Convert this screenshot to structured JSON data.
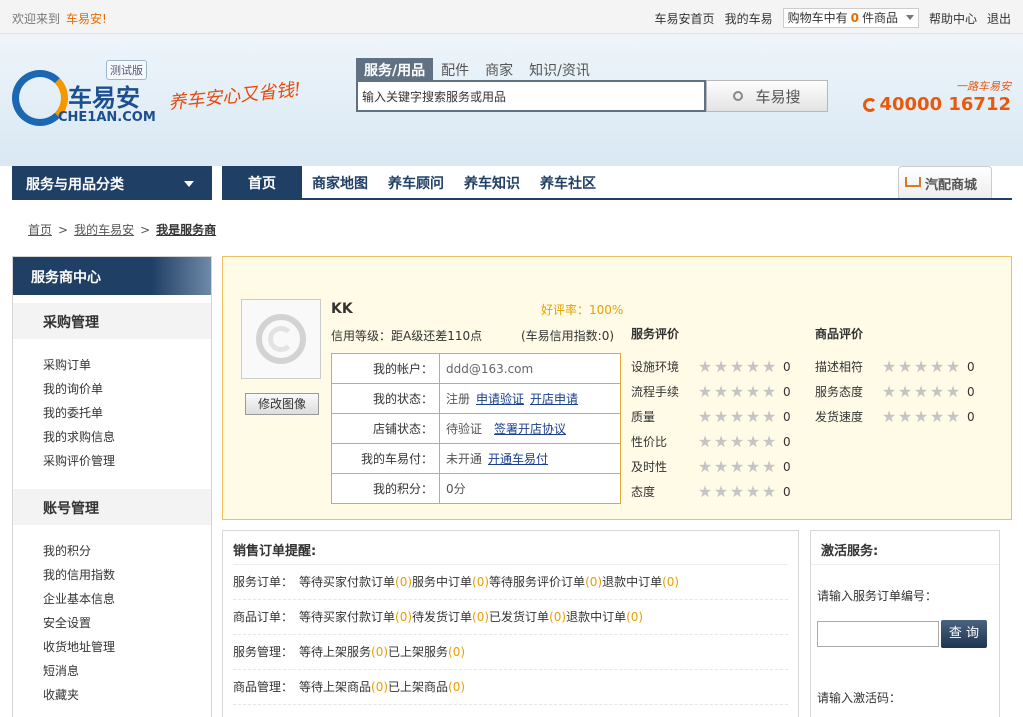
{
  "topbar": {
    "welcome": "欢迎来到",
    "brand": "车易安!",
    "links": [
      "车易安首页",
      "我的车易"
    ],
    "cart_prefix": "购物车中有",
    "cart_count": "0",
    "cart_suffix": "件商品",
    "help": "帮助中心",
    "logout": "退出"
  },
  "header": {
    "logo_cn": "车易安",
    "logo_en": "CHE1AN.COM",
    "test_tag": "测试版",
    "slogan": "养车安心又省钱!",
    "search_tabs": [
      "服务/用品",
      "配件",
      "商家",
      "知识/资讯"
    ],
    "search_placeholder": "输入关键字搜索服务或用品",
    "search_button": "车易搜",
    "hotline_tag": "一路车易安",
    "hotline": "40000 16712"
  },
  "nav": {
    "category": "服务与用品分类",
    "items": [
      "首页",
      "商家地图",
      "养车顾问",
      "养车知识",
      "养车社区"
    ],
    "mall": "汽配商城"
  },
  "breadcrumb": [
    "首页",
    "我的车易安",
    "我是服务商"
  ],
  "sidebar": {
    "head": "服务商中心",
    "groups": [
      {
        "title": "采购管理",
        "items": [
          "采购订单",
          "我的询价单",
          "我的委托单",
          "我的求购信息",
          "采购评价管理"
        ]
      },
      {
        "title": "账号管理",
        "items": [
          "我的积分",
          "我的信用指数",
          "企业基本信息",
          "安全设置",
          "收货地址管理",
          "短消息",
          "收藏夹"
        ]
      }
    ]
  },
  "profile": {
    "change_avatar": "修改图像",
    "name": "KK",
    "rate": "好评率：100%",
    "credit": "信用等级：距A级还差110点",
    "credit_index": "(车易信用指数:0)",
    "account_label": "我的帐户：",
    "account_value": "ddd@163.com",
    "status_label": "我的状态：",
    "status_value": "注册",
    "status_link1": "申请验证",
    "status_link2": "开店申请",
    "shop_label": "店铺状态：",
    "shop_value": "待验证",
    "shop_link": "签署开店协议",
    "card_label": "我的车易付：",
    "card_value": "未开通",
    "card_link": "开通车易付",
    "points_label": "我的积分：",
    "points_value": "0分",
    "service_eval_title": "服务评价",
    "service_eval": [
      {
        "label": "设施环境",
        "score": "0"
      },
      {
        "label": "流程手续",
        "score": "0"
      },
      {
        "label": "质量",
        "score": "0"
      },
      {
        "label": "性价比",
        "score": "0"
      },
      {
        "label": "及时性",
        "score": "0"
      },
      {
        "label": "态度",
        "score": "0"
      }
    ],
    "goods_eval_title": "商品评价",
    "goods_eval": [
      {
        "label": "描述相符",
        "score": "0"
      },
      {
        "label": "服务态度",
        "score": "0"
      },
      {
        "label": "发货速度",
        "score": "0"
      }
    ]
  },
  "orders": {
    "title": "销售订单提醒:",
    "rows": [
      {
        "cat": "服务订单：",
        "entries": [
          [
            "等待买家付款订单",
            "(0)"
          ],
          [
            "服务中订单",
            "(0)"
          ],
          [
            "等待服务评价订单",
            "(0)"
          ],
          [
            "退款中订单",
            "(0)"
          ]
        ]
      },
      {
        "cat": "商品订单：",
        "entries": [
          [
            "等待买家付款订单",
            "(0)"
          ],
          [
            "待发货订单",
            "(0)"
          ],
          [
            "已发货订单",
            "(0)"
          ],
          [
            "退款中订单",
            "(0)"
          ]
        ]
      },
      {
        "cat": "服务管理：",
        "entries": [
          [
            "等待上架服务",
            "(0)"
          ],
          [
            "已上架服务",
            "(0)"
          ]
        ]
      },
      {
        "cat": "商品管理：",
        "entries": [
          [
            "等待上架商品",
            "(0)"
          ],
          [
            "已上架商品",
            "(0)"
          ]
        ]
      }
    ]
  },
  "activate": {
    "title": "激活服务:",
    "order_label": "请输入服务订单编号：",
    "query_button": "查 询",
    "code_label": "请输入激活码："
  }
}
